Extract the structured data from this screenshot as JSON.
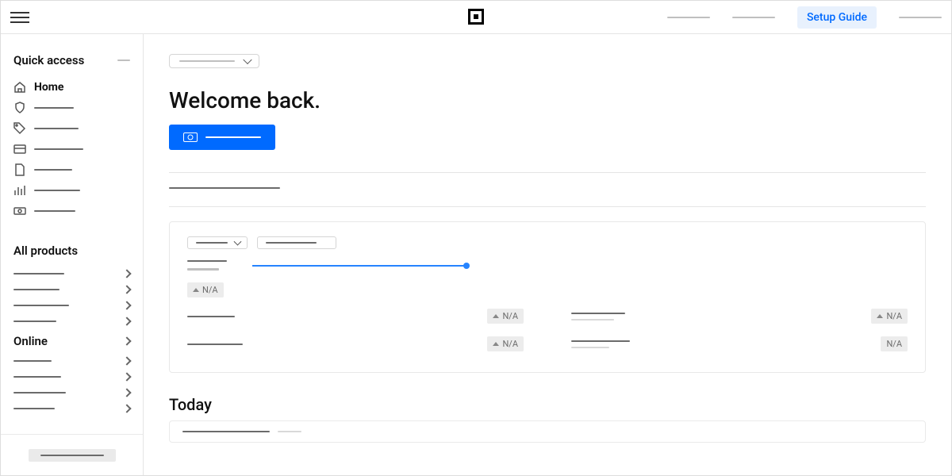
{
  "topbar": {
    "setup_guide": "Setup Guide"
  },
  "sidebar": {
    "quick_access_title": "Quick access",
    "home_label": "Home",
    "all_products_title": "All products",
    "online_label": "Online"
  },
  "main": {
    "welcome": "Welcome back.",
    "today": "Today",
    "na": "N/A"
  }
}
